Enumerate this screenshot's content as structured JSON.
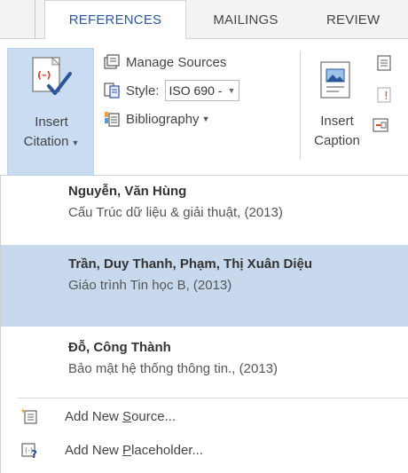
{
  "tabs": {
    "references": "REFERENCES",
    "mailings": "MAILINGS",
    "review": "REVIEW"
  },
  "ribbon": {
    "insert_citation": {
      "line1": "Insert",
      "line2": "Citation",
      "icon": "insert-citation-icon"
    },
    "manage_sources": {
      "label": "Manage Sources",
      "icon": "manage-sources-icon"
    },
    "style": {
      "label": "Style:",
      "value": "ISO 690 -",
      "icon": "style-icon"
    },
    "bibliography": {
      "label": "Bibliography",
      "icon": "bibliography-icon"
    },
    "insert_caption": {
      "line1": "Insert",
      "line2": "Caption",
      "icon": "insert-caption-icon"
    }
  },
  "menu": {
    "sources": [
      {
        "author": "Nguyễn, Văn Hùng",
        "title": "Cấu Trúc dữ liệu & giải thuật, (2013)"
      },
      {
        "author": "Trần, Duy Thanh,  Phạm, Thị Xuân Diệu",
        "title": "Giáo trình Tin học B, (2013)"
      },
      {
        "author": "Đỗ, Công Thành",
        "title": "Bảo mật hệ thống thông tin., (2013)"
      }
    ],
    "add_new_source": {
      "before": "Add New ",
      "accel": "S",
      "after": "ource..."
    },
    "add_new_placeholder": {
      "before": "Add New ",
      "accel": "P",
      "after": "laceholder..."
    }
  },
  "colors": {
    "accent": "#2b579a",
    "highlight": "#c8d9ee",
    "pressed": "#c9dcf1",
    "citation_red": "#d24726"
  }
}
